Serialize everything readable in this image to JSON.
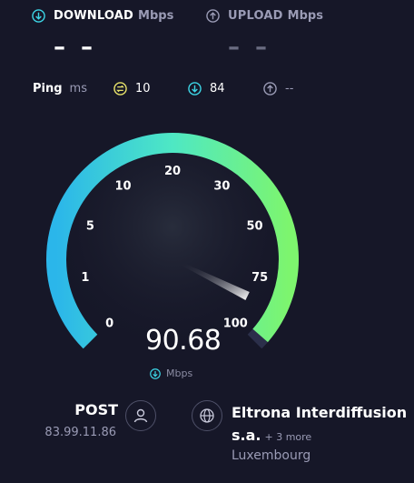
{
  "metrics": {
    "download": {
      "label": "DOWNLOAD",
      "unit": "Mbps",
      "value": "– –"
    },
    "upload": {
      "label": "UPLOAD",
      "unit": "Mbps",
      "value": "– –"
    }
  },
  "ping": {
    "label": "Ping",
    "unit": "ms",
    "idle": "10",
    "download": "84",
    "upload": "--"
  },
  "gauge": {
    "ticks": [
      "0",
      "1",
      "5",
      "10",
      "20",
      "30",
      "50",
      "75",
      "100"
    ],
    "speed": "90.68",
    "unit": "Mbps",
    "fraction": 0.985
  },
  "isp": {
    "name": "POST",
    "ip": "83.99.11.86"
  },
  "server": {
    "name": "Eltrona Interdiffusion s.a.",
    "more": "+ 3 more",
    "location": "Luxembourg"
  },
  "colors": {
    "background": "#161728",
    "accent_cyan": "#3dd6e6",
    "accent_green": "#7af27a",
    "ping_idle": "#e8e36a"
  }
}
